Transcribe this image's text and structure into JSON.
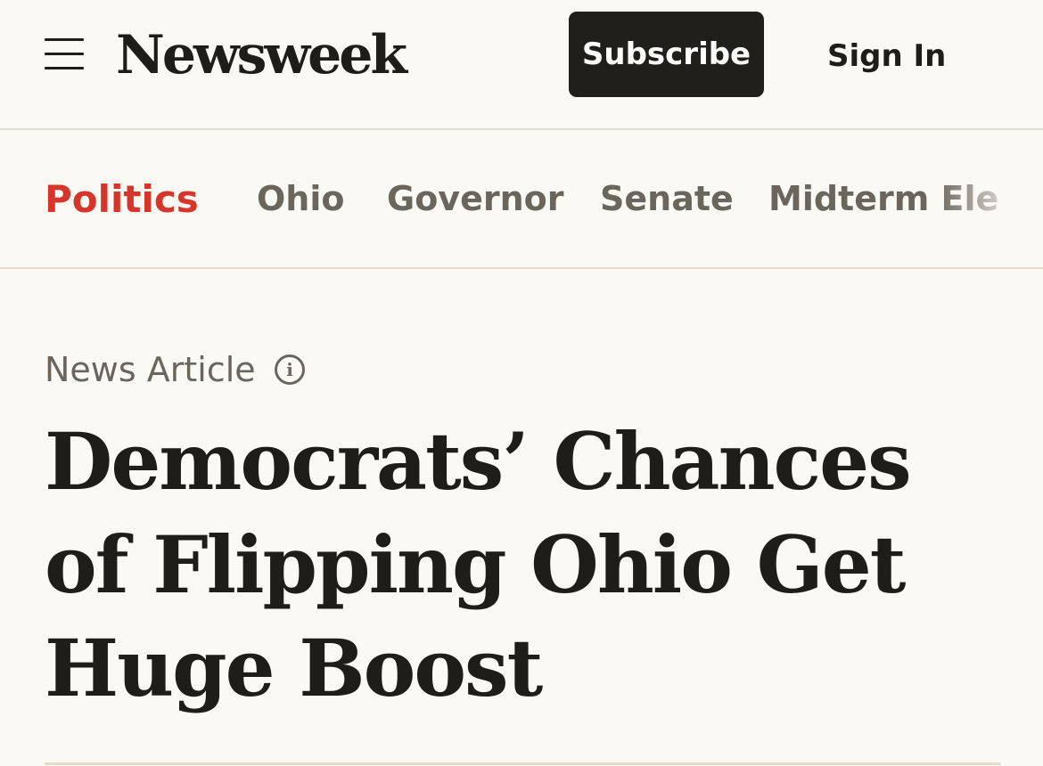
{
  "header": {
    "menu_icon": "hamburger-menu-icon",
    "logo": "Newsweek",
    "subscribe_label": "Subscribe",
    "signin_label": "Sign In"
  },
  "nav": {
    "section": "Politics",
    "links": [
      "Ohio",
      "Governor",
      "Senate",
      "Midterm Ele"
    ]
  },
  "article": {
    "kicker": "News Article",
    "info_icon": "info-icon",
    "headline": "Democrats’ Chances of Flipping Ohio Get Huge Boost"
  },
  "colors": {
    "background": "#fbf9f4",
    "section_accent": "#d7342c",
    "button_bg": "#211f1b",
    "muted_text": "#6b665d",
    "rule": "#e4dccb"
  }
}
